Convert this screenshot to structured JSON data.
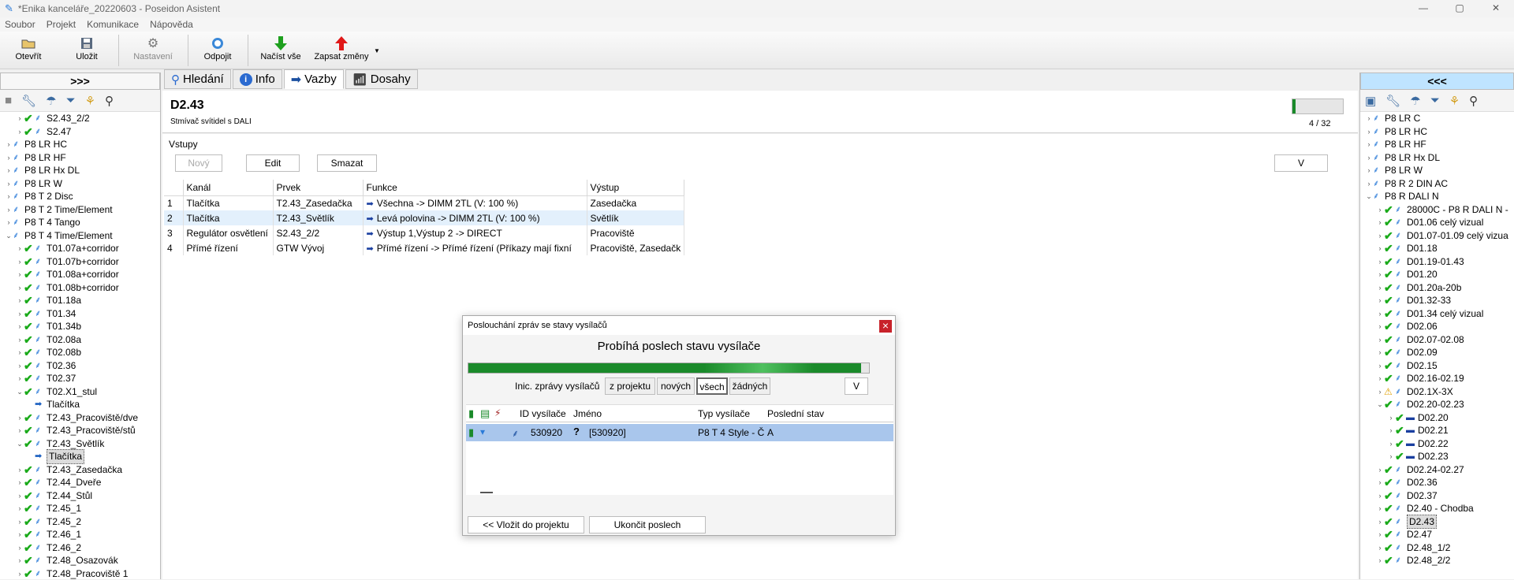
{
  "window": {
    "title": "*Enika kanceláře_20220603 - Poseidon Asistent",
    "controls": [
      "—",
      "▢",
      "✕"
    ]
  },
  "menu": [
    "Soubor",
    "Projekt",
    "Komunikace",
    "Nápověda"
  ],
  "toolbar": {
    "open": "Otevřít",
    "save": "Uložit",
    "settings": "Nastavení",
    "disconnect": "Odpojit",
    "load_all": "Načíst vše",
    "write_changes": "Zapsat změny"
  },
  "left_panel": {
    "header": ">>>",
    "tree": [
      {
        "label": "S2.43_2/2",
        "level": 1,
        "chk": true
      },
      {
        "label": "S2.47",
        "level": 1,
        "chk": true
      },
      {
        "label": "P8 LR HC",
        "level": 0,
        "chk": false
      },
      {
        "label": "P8 LR HF",
        "level": 0,
        "chk": false
      },
      {
        "label": "P8 LR Hx DL",
        "level": 0,
        "chk": false
      },
      {
        "label": "P8 LR W",
        "level": 0,
        "chk": false
      },
      {
        "label": "P8 T 2 Disc",
        "level": 0,
        "chk": false
      },
      {
        "label": "P8 T 2 Time/Element",
        "level": 0,
        "chk": false
      },
      {
        "label": "P8 T 4 Tango",
        "level": 0,
        "chk": false
      },
      {
        "label": "P8 T 4 Time/Element",
        "level": 0,
        "chk": false,
        "open": true
      },
      {
        "label": "T01.07a+corridor",
        "level": 1,
        "chk": true
      },
      {
        "label": "T01.07b+corridor",
        "level": 1,
        "chk": true
      },
      {
        "label": "T01.08a+corridor",
        "level": 1,
        "chk": true
      },
      {
        "label": "T01.08b+corridor",
        "level": 1,
        "chk": true
      },
      {
        "label": "T01.18a",
        "level": 1,
        "chk": true
      },
      {
        "label": "T01.34",
        "level": 1,
        "chk": true
      },
      {
        "label": "T01.34b",
        "level": 1,
        "chk": true
      },
      {
        "label": "T02.08a",
        "level": 1,
        "chk": true
      },
      {
        "label": "T02.08b",
        "level": 1,
        "chk": true
      },
      {
        "label": "T02.36",
        "level": 1,
        "chk": true
      },
      {
        "label": "T02.37",
        "level": 1,
        "chk": true
      },
      {
        "label": "T02.X1_stul",
        "level": 1,
        "chk": true,
        "open": true
      },
      {
        "label": "Tlačítka",
        "level": 2,
        "chk": false,
        "arrow": true
      },
      {
        "label": "T2.43_Pracoviště/dve",
        "level": 1,
        "chk": true
      },
      {
        "label": "T2.43_Pracoviště/stů",
        "level": 1,
        "chk": true
      },
      {
        "label": "T2.43_Světlík",
        "level": 1,
        "chk": true,
        "open": true
      },
      {
        "label": "Tlačítka",
        "level": 2,
        "chk": false,
        "arrow": true,
        "selected": true
      },
      {
        "label": "T2.43_Zasedačka",
        "level": 1,
        "chk": true
      },
      {
        "label": "T2.44_Dveře",
        "level": 1,
        "chk": true
      },
      {
        "label": "T2.44_Stůl",
        "level": 1,
        "chk": true
      },
      {
        "label": "T2.45_1",
        "level": 1,
        "chk": true
      },
      {
        "label": "T2.45_2",
        "level": 1,
        "chk": true
      },
      {
        "label": "T2.46_1",
        "level": 1,
        "chk": true
      },
      {
        "label": "T2.46_2",
        "level": 1,
        "chk": true
      },
      {
        "label": "T2.48_Osazovák",
        "level": 1,
        "chk": true
      },
      {
        "label": "T2.48_Pracoviště 1",
        "level": 1,
        "chk": true
      }
    ]
  },
  "right_panel": {
    "header": "<<<",
    "tree": [
      {
        "label": "P8 LR C",
        "level": 0,
        "chk": false
      },
      {
        "label": "P8 LR HC",
        "level": 0,
        "chk": false
      },
      {
        "label": "P8 LR HF",
        "level": 0,
        "chk": false
      },
      {
        "label": "P8 LR Hx DL",
        "level": 0,
        "chk": false
      },
      {
        "label": "P8 LR W",
        "level": 0,
        "chk": false
      },
      {
        "label": "P8 R 2 DIN AC",
        "level": 0,
        "chk": false
      },
      {
        "label": "P8 R DALI N",
        "level": 0,
        "chk": false,
        "open": true
      },
      {
        "label": "28000C - P8 R DALI N -",
        "level": 1,
        "chk": true
      },
      {
        "label": "D01.06 celý vizual",
        "level": 1,
        "chk": true
      },
      {
        "label": "D01.07-01.09 celý vizua",
        "level": 1,
        "chk": true
      },
      {
        "label": "D01.18",
        "level": 1,
        "chk": true
      },
      {
        "label": "D01.19-01.43",
        "level": 1,
        "chk": true
      },
      {
        "label": "D01.20",
        "level": 1,
        "chk": true
      },
      {
        "label": "D01.20a-20b",
        "level": 1,
        "chk": true
      },
      {
        "label": "D01.32-33",
        "level": 1,
        "chk": true
      },
      {
        "label": "D01.34 celý vizual",
        "level": 1,
        "chk": true
      },
      {
        "label": "D02.06",
        "level": 1,
        "chk": true
      },
      {
        "label": "D02.07-02.08",
        "level": 1,
        "chk": true
      },
      {
        "label": "D02.09",
        "level": 1,
        "chk": true
      },
      {
        "label": "D02.15",
        "level": 1,
        "chk": true
      },
      {
        "label": "D02.16-02.19",
        "level": 1,
        "chk": true
      },
      {
        "label": "D02.1X-3X",
        "level": 1,
        "chk": false,
        "warn": true
      },
      {
        "label": "D02.20-02.23",
        "level": 1,
        "chk": true,
        "open": true
      },
      {
        "label": "D02.20",
        "level": 2,
        "chk": true,
        "dali": true
      },
      {
        "label": "D02.21",
        "level": 2,
        "chk": true,
        "dali": true
      },
      {
        "label": "D02.22",
        "level": 2,
        "chk": true,
        "dali": true
      },
      {
        "label": "D02.23",
        "level": 2,
        "chk": true,
        "dali": true
      },
      {
        "label": "D02.24-02.27",
        "level": 1,
        "chk": true
      },
      {
        "label": "D02.36",
        "level": 1,
        "chk": true
      },
      {
        "label": "D02.37",
        "level": 1,
        "chk": true
      },
      {
        "label": "D2.40 - Chodba",
        "level": 1,
        "chk": true
      },
      {
        "label": "D2.43",
        "level": 1,
        "chk": true,
        "selected": true
      },
      {
        "label": "D2.47",
        "level": 1,
        "chk": true
      },
      {
        "label": "D2.48_1/2",
        "level": 1,
        "chk": true
      },
      {
        "label": "D2.48_2/2",
        "level": 1,
        "chk": true
      }
    ]
  },
  "tabs": [
    {
      "label": "Hledání",
      "icon": "search-icon",
      "active": false
    },
    {
      "label": "Info",
      "icon": "info-icon",
      "active": false
    },
    {
      "label": "Vazby",
      "icon": "arrow-right-icon",
      "active": true
    },
    {
      "label": "Dosahy",
      "icon": "signal-icon",
      "active": false
    }
  ],
  "device": {
    "name": "D2.43",
    "description": "Stmívač svítidel s DALI",
    "counter": "4 / 32",
    "progress": 0.06
  },
  "inputs": {
    "section_label": "Vstupy",
    "new_label": "Nový",
    "edit_label": "Edit",
    "delete_label": "Smazat",
    "v_label": "V",
    "columns": [
      "",
      "Kanál",
      "Prvek",
      "Funkce",
      "Výstup"
    ],
    "rows": [
      {
        "n": "1",
        "kanal": "Tlačítka",
        "prvek": "T2.43_Zasedačka",
        "funkce": "Všechna -> DIMM 2TL (V: 100 %)",
        "vystup": "Zasedačka"
      },
      {
        "n": "2",
        "kanal": "Tlačítka",
        "prvek": "T2.43_Světlík",
        "funkce": "Levá polovina -> DIMM 2TL (V: 100 %)",
        "vystup": "Světlík"
      },
      {
        "n": "3",
        "kanal": "Regulátor osvětlení",
        "prvek": "S2.43_2/2",
        "funkce": "Výstup 1,Výstup 2 -> DIRECT",
        "vystup": "Pracoviště"
      },
      {
        "n": "4",
        "kanal": "Přímé řízení",
        "prvek": "GTW Vývoj",
        "funkce": "Přímé řízení -> Přímé řízení    (Příkazy mají fixní",
        "vystup": "Pracoviště, Zasedačk"
      }
    ]
  },
  "dialog": {
    "title": "Poslouchání zpráv se stavy vysílačů",
    "heading": "Probíhá poslech stavu vysílače",
    "progress": 0.98,
    "filter_label": "Inic. zprávy vysílačů",
    "filter_options": [
      "z projektu",
      "nových",
      "všech",
      "žádných"
    ],
    "filter_selected": "všech",
    "v_label": "V",
    "columns": [
      "ID vysílače",
      "Jméno",
      "Typ vysílače",
      "Poslední stav"
    ],
    "rows": [
      {
        "id": "530920",
        "jmeno": "[530920]",
        "typ": "P8 T 4 Style - Č",
        "stav": "A"
      }
    ],
    "add_button": "<< Vložit do projektu",
    "stop_button": "Ukončit poslech",
    "close": "×"
  }
}
